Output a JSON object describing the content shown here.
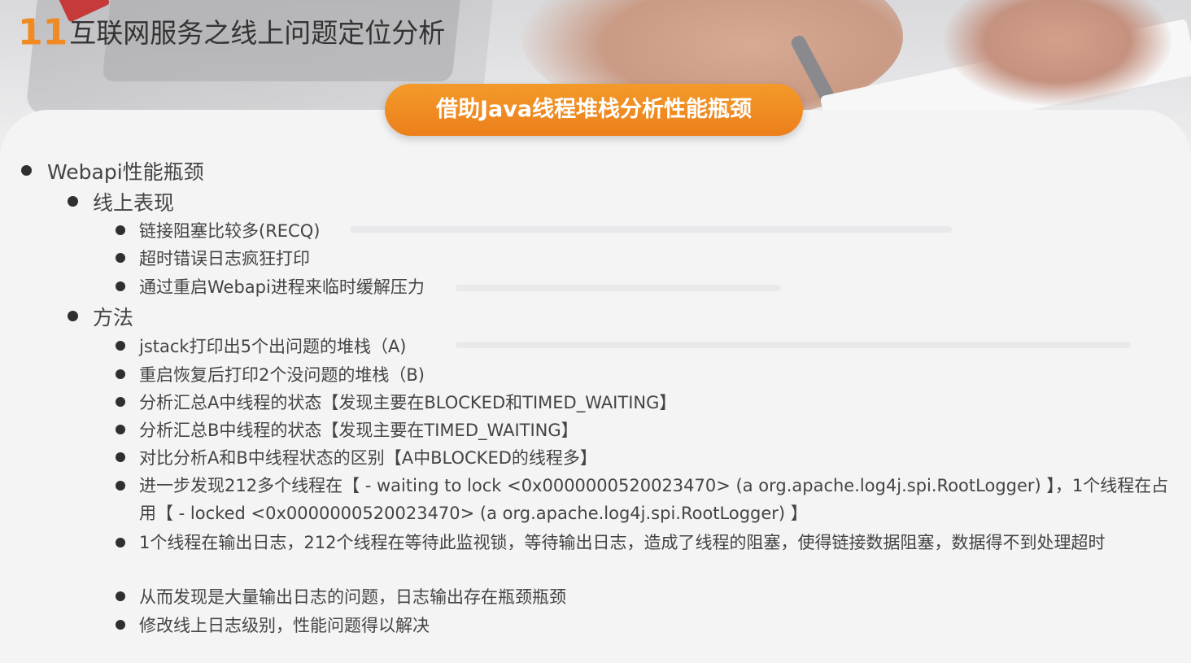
{
  "title": {
    "number": "11",
    "text": "互联网服务之线上问题定位分析"
  },
  "banner": {
    "label": "借助Java线程堆栈分析性能瓶颈"
  },
  "outline": {
    "root": "Webapi性能瓶颈",
    "section_symptoms": "线上表现",
    "symptoms": [
      "链接阻塞比较多(RECQ)",
      "超时错误日志疯狂打印",
      "通过重启Webapi进程来临时缓解压力"
    ],
    "section_method": "方法",
    "methods": [
      "jstack打印出5个出问题的堆栈（A)",
      "重启恢复后打印2个没问题的堆栈（B)",
      "分析汇总A中线程的状态【发现主要在BLOCKED和TIMED_WAITING】",
      "分析汇总B中线程的状态【发现主要在TIMED_WAITING】",
      "对比分析A和B中线程状态的区别【A中BLOCKED的线程多】",
      "进一步发现212多个线程在【 - waiting to lock <0x0000000520023470> (a org.apache.log4j.spi.RootLogger) 】，1个线程在占用【 - locked <0x0000000520023470> (a org.apache.log4j.spi.RootLogger) 】",
      "1个线程在输出日志，212个线程在等待此监视锁，等待输出日志，造成了线程的阻塞，使得链接数据阻塞，数据得不到处理超时",
      "从而发现是大量输出日志的问题，日志输出存在瓶颈瓶颈",
      "修改线上日志级别，性能问题得以解决"
    ]
  },
  "colors": {
    "accent": "#f08a23",
    "banner_bg": "#ee871f",
    "text": "#444444",
    "card_bg": "#f4f4f5"
  }
}
